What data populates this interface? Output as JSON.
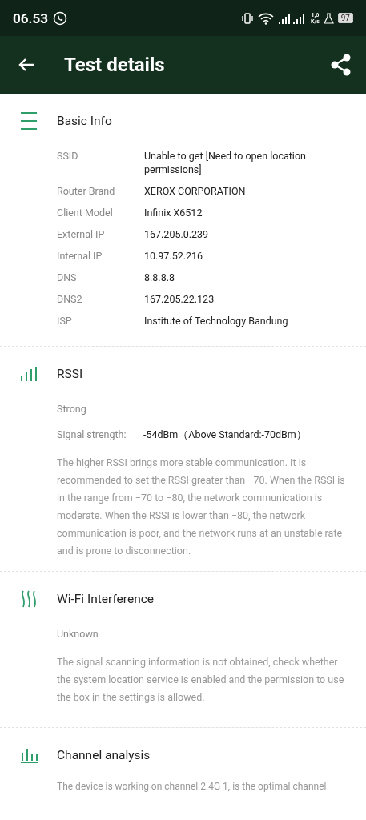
{
  "status_bar": {
    "time": "06.53",
    "speed_value": "1,6",
    "speed_unit": "K/s",
    "battery": "97"
  },
  "app_bar": {
    "title": "Test details"
  },
  "sections": [
    {
      "kind": "info",
      "title": "Basic Info",
      "rows": [
        {
          "label": "SSID",
          "value": "Unable to get [Need to open location permissions]"
        },
        {
          "label": "Router Brand",
          "value": "XEROX CORPORATION"
        },
        {
          "label": "Client Model",
          "value": "Infinix X6512"
        },
        {
          "label": "External IP",
          "value": "167.205.0.239"
        },
        {
          "label": "Internal IP",
          "value": "10.97.52.216"
        },
        {
          "label": "DNS",
          "value": "8.8.8.8"
        },
        {
          "label": "DNS2",
          "value": "167.205.22.123"
        },
        {
          "label": "ISP",
          "value": "Institute of Technology Bandung"
        }
      ]
    },
    {
      "kind": "rssi",
      "title": "RSSI",
      "status": "Strong",
      "signal_label": "Signal strength:",
      "signal_value": "-54dBm（Above Standard:-70dBm）",
      "description": "The higher RSSI brings more stable communication. It is recommended to set the RSSI greater than −70. When the RSSI is in the range from −70 to −80, the network communication is moderate. When the RSSI is lower than −80, the network communication is poor, and the network runs at an unstable rate and is prone to disconnection."
    },
    {
      "kind": "interference",
      "title": "Wi-Fi Interference",
      "status": "Unknown",
      "description": "The signal scanning information is not obtained, check whether the system location service is enabled and the permission to use the box in the settings is allowed."
    },
    {
      "kind": "channel",
      "title": "Channel analysis",
      "description": "The device is working on channel 2.4G 1, is the optimal channel"
    }
  ]
}
